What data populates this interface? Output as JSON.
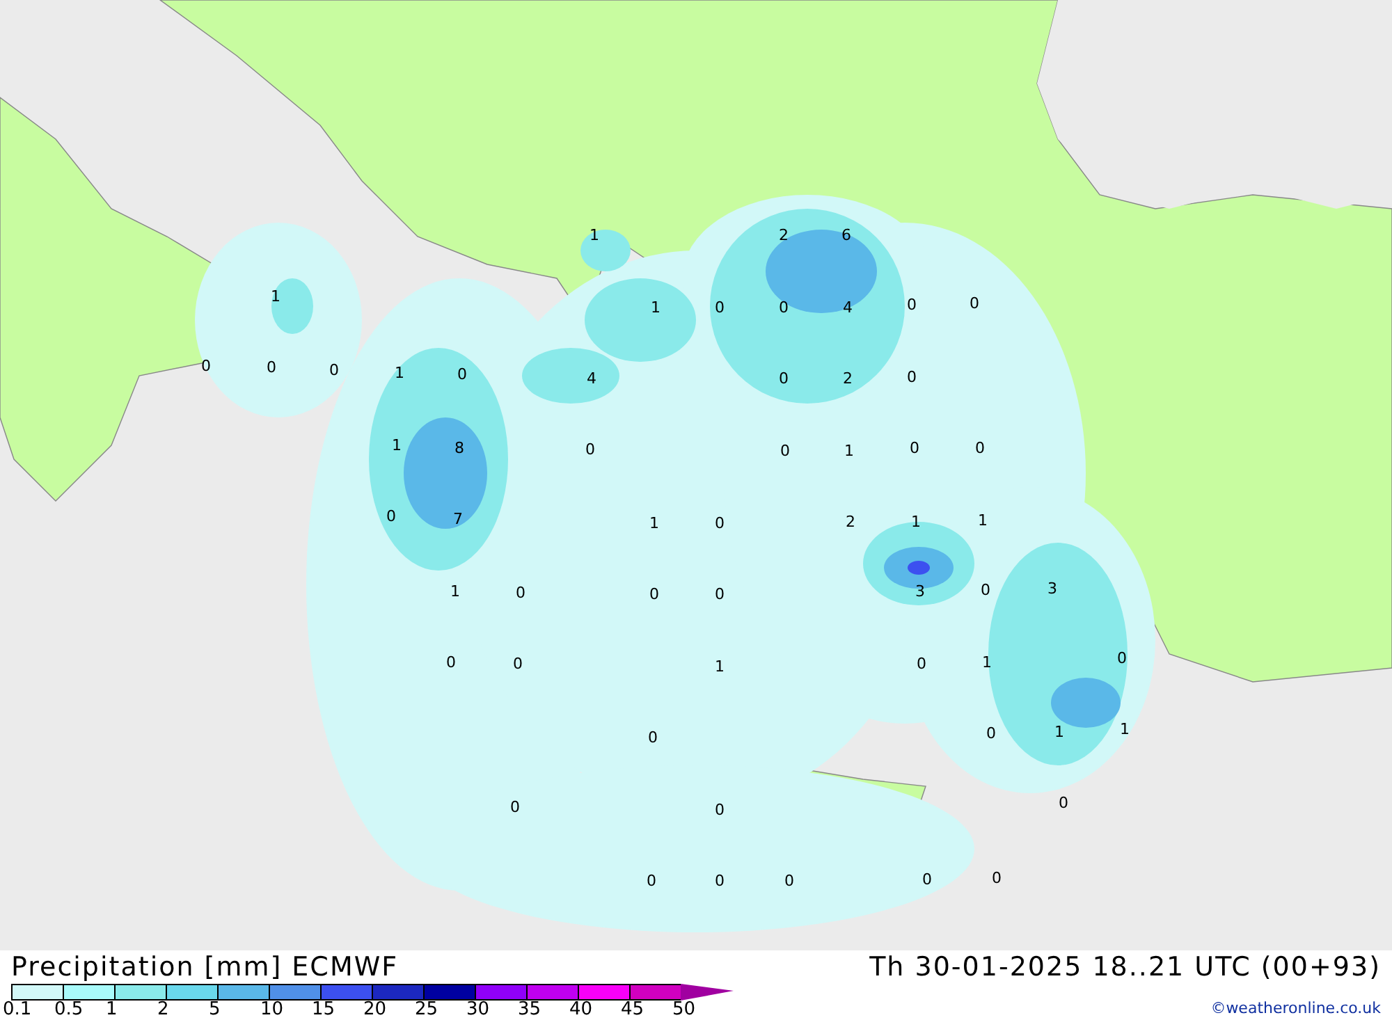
{
  "map": {
    "values": [
      "1",
      "2",
      "6",
      "1",
      "1",
      "0",
      "0",
      "4",
      "0",
      "0",
      "0",
      "0",
      "0",
      "1",
      "0",
      "4",
      "0",
      "2",
      "0",
      "1",
      "8",
      "0",
      "0",
      "1",
      "0",
      "0",
      "0",
      "7",
      "1",
      "0",
      "2",
      "1",
      "1",
      "1",
      "0",
      "0",
      "0",
      "3",
      "0",
      "3",
      "0",
      "0",
      "1",
      "0",
      "1",
      "0",
      "0",
      "0",
      "1",
      "1",
      "0",
      "0",
      "0",
      "0",
      "0",
      "0",
      "0",
      "0"
    ]
  },
  "footer": {
    "title": "Precipitation [mm] ECMWF",
    "valid_time": "Th 30-01-2025 18..21 UTC (00+93)",
    "credit": "©weatheronline.co.uk",
    "legend": {
      "swatches": [
        {
          "color": "#d2f8f8"
        },
        {
          "color": "#a8fafa"
        },
        {
          "color": "#8aeaea"
        },
        {
          "color": "#6ad8ec"
        },
        {
          "color": "#5ab8e8"
        },
        {
          "color": "#5090e8"
        },
        {
          "color": "#3c50f0"
        },
        {
          "color": "#1c28c0"
        },
        {
          "color": "#0000a0"
        },
        {
          "color": "#9000f8"
        },
        {
          "color": "#c000f0"
        },
        {
          "color": "#f800f8"
        },
        {
          "color": "#d000c0"
        }
      ],
      "ticks": [
        "0.1",
        "0.5",
        "1",
        "2",
        "5",
        "10",
        "15",
        "20",
        "25",
        "30",
        "35",
        "40",
        "45",
        "50"
      ]
    }
  }
}
